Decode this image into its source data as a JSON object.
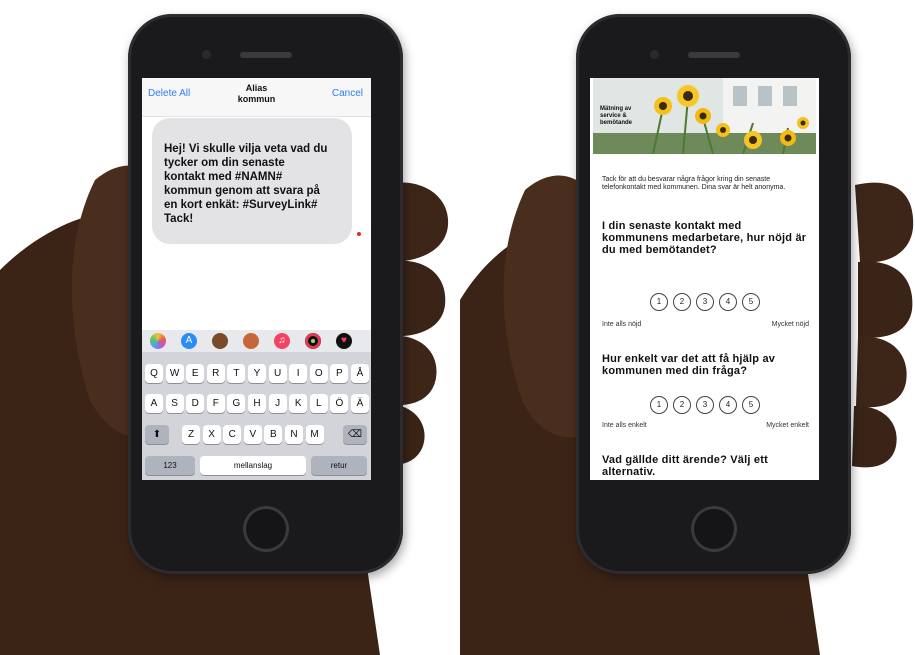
{
  "sms": {
    "nav_left": "Delete All",
    "nav_title_1": "Alias",
    "nav_title_2": "kommun",
    "nav_right": "Cancel",
    "message": "Hej! Vi skulle vilja veta vad du\ntycker om din senaste\nkontakt med #NAMN#\nkommun genom att svara på\nen kort enkät: #SurveyLink#\nTack!"
  },
  "keyboard": {
    "app_icons": [
      "photos-icon",
      "app-store-icon",
      "memoji-icon",
      "memoji-icon-2",
      "music-icon",
      "activity-icon",
      "heart-icon"
    ],
    "row1": [
      "Q",
      "W",
      "E",
      "R",
      "T",
      "Y",
      "U",
      "I",
      "O",
      "P",
      "Å"
    ],
    "row2": [
      "A",
      "S",
      "D",
      "F",
      "G",
      "H",
      "J",
      "K",
      "L",
      "Ö",
      "Ä"
    ],
    "row3": [
      "Z",
      "X",
      "C",
      "V",
      "B",
      "N",
      "M"
    ],
    "num_key": "123",
    "space_key": "mellanslag",
    "return_key": "retur"
  },
  "survey": {
    "hero_caption": "Mätning av\nservice &\nbemötande",
    "intro": "Tack för att du besvarar några frågor kring din senaste telefonkontakt med kommunen. Dina svar är helt anonyma.",
    "q1": "I din senaste kontakt med kommunens medarbetare, hur nöjd är du med bemötandet?",
    "q1_low": "Inte alls nöjd",
    "q1_high": "Mycket nöjd",
    "q2": "Hur enkelt var det att få hjälp av kommunen med din fråga?",
    "q2_low": "Inte alls enkelt",
    "q2_high": "Mycket enkelt",
    "q3": "Vad gällde ditt ärende? Välj ett alternativ.",
    "scale": [
      "1",
      "2",
      "3",
      "4",
      "5"
    ]
  }
}
